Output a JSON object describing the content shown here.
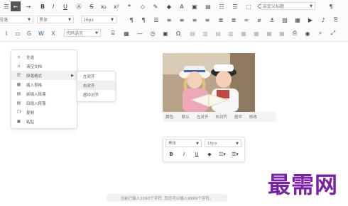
{
  "toolbar": {
    "row2": {
      "paragraph_select": "段落",
      "font_select": "黑体",
      "size_select": "16px"
    },
    "row1": {
      "custom_title_select": "自定义标题"
    },
    "row3": {
      "code_lang_select": "代码语言"
    }
  },
  "context_menu": {
    "items": [
      {
        "label": "全选",
        "icon": "select-all-icon"
      },
      {
        "label": "清空文档",
        "icon": "clear-doc-icon"
      },
      {
        "label": "段落格式",
        "icon": "paragraph-format-icon"
      },
      {
        "label": "插入表格",
        "icon": "table-icon"
      },
      {
        "label": "前插入段落",
        "icon": "insert-before-icon"
      },
      {
        "label": "后插入段落",
        "icon": "insert-after-icon"
      },
      {
        "label": "复制",
        "icon": "copy-icon"
      },
      {
        "label": "粘贴",
        "icon": "paste-icon"
      }
    ],
    "submenu": [
      {
        "label": "左对齐"
      },
      {
        "label": "右对齐"
      },
      {
        "label": "居中对齐"
      }
    ]
  },
  "image_toolbar": {
    "label": "属性:",
    "items": [
      "默认",
      "左对齐",
      "右对齐",
      "居中",
      "修改"
    ]
  },
  "floating_editor": {
    "font_select": "黑体",
    "size_select": "16px"
  },
  "status_text": "当前已输入1093个字符, 您还可以输入9999个字符。",
  "watermark": "最需网",
  "colors": {
    "accent": "#555555",
    "watermark": "#7a1fa8"
  }
}
